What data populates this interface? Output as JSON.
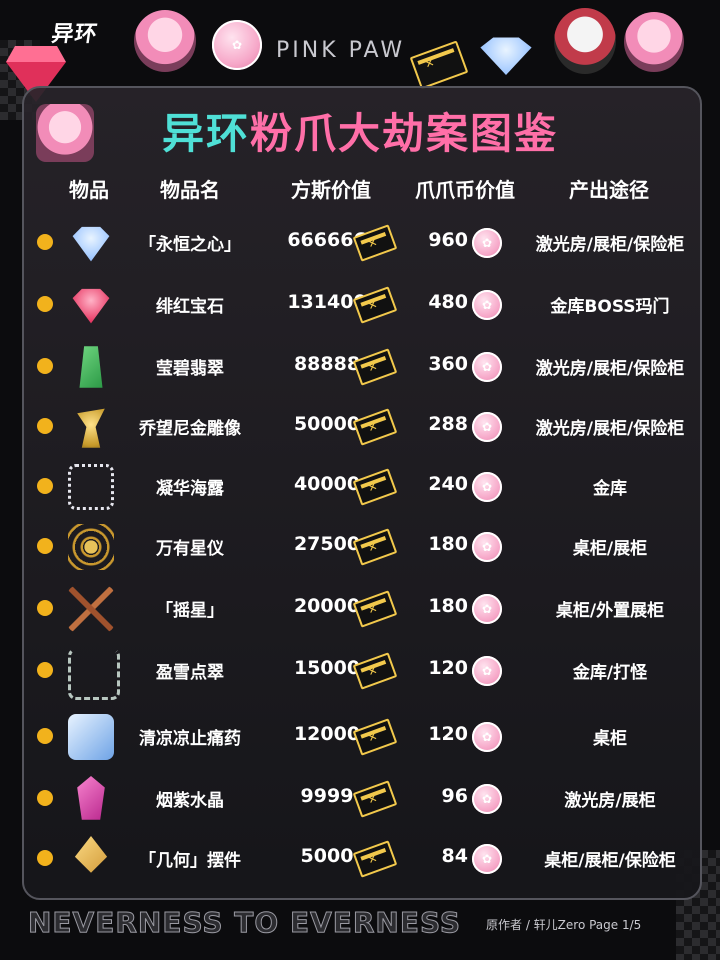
{
  "header": {
    "brand": "异环",
    "pink_paw": "PINK PAW"
  },
  "title": {
    "part1": "异环",
    "part2": "粉爪大劫案图鉴"
  },
  "columns": [
    "物品",
    "物品名",
    "方斯价值",
    "爪爪币价值",
    "产出途径"
  ],
  "items": [
    {
      "icon": "diamond-icon",
      "name": "「永恒之心」",
      "fs": "666666",
      "pz": "960",
      "src": "激光房/展柜/保险柜"
    },
    {
      "icon": "ruby-icon",
      "name": "绯红宝石",
      "fs": "131400",
      "pz": "480",
      "src": "金库BOSS玛门"
    },
    {
      "icon": "emerald-icon",
      "name": "莹碧翡翠",
      "fs": "88888",
      "pz": "360",
      "src": "激光房/展柜/保险柜"
    },
    {
      "icon": "gold-statue-icon",
      "name": "乔望尼金雕像",
      "fs": "50000",
      "pz": "288",
      "src": "激光房/展柜/保险柜"
    },
    {
      "icon": "pearl-necklace-icon",
      "name": "凝华海露",
      "fs": "40000",
      "pz": "240",
      "src": "金库"
    },
    {
      "icon": "armillary-sphere-icon",
      "name": "万有星仪",
      "fs": "27500",
      "pz": "180",
      "src": "桌柜/展柜"
    },
    {
      "icon": "crossbow-icon",
      "name": "「摇星」",
      "fs": "20000",
      "pz": "180",
      "src": "桌柜/外置展柜"
    },
    {
      "icon": "emerald-necklace-icon",
      "name": "盈雪点翠",
      "fs": "15000",
      "pz": "120",
      "src": "金库/打怪"
    },
    {
      "icon": "medicine-box-icon",
      "name": "清凉凉止痛药",
      "fs": "12000",
      "pz": "120",
      "src": "桌柜"
    },
    {
      "icon": "amethyst-icon",
      "name": "烟紫水晶",
      "fs": "9999",
      "pz": "96",
      "src": "激光房/展柜"
    },
    {
      "icon": "geometry-ornament-icon",
      "name": "「几何」摆件",
      "fs": "5000",
      "pz": "84",
      "src": "桌柜/展柜/保险柜"
    }
  ],
  "footer": {
    "slogan": "NEVERNESS TO EVERNESS",
    "credit": "原作者 / 轩儿Zero Page 1/5"
  },
  "colors": {
    "title_cyan": "#4fe0d6",
    "title_pink": "#ff6fa8",
    "bullet": "#f2b21c",
    "ticket_gold": "#f2c94c"
  }
}
